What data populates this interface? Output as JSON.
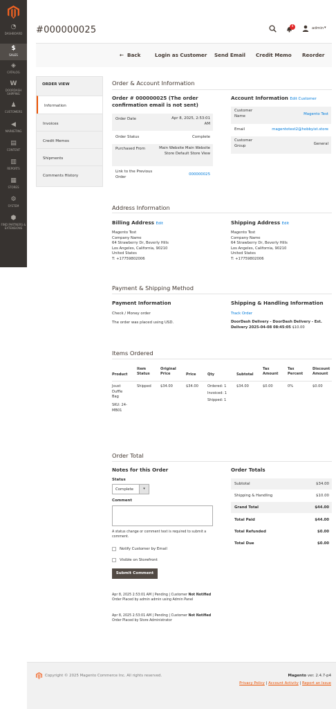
{
  "sidebar": {
    "items": [
      {
        "label": "DASHBOARD",
        "icon": "dashboard-icon"
      },
      {
        "label": "SALES",
        "icon": "dollar-icon"
      },
      {
        "label": "CATALOG",
        "icon": "cube-icon"
      },
      {
        "label": "DOORDASH SHIPPING",
        "icon": "doordash-icon"
      },
      {
        "label": "CUSTOMERS",
        "icon": "person-icon"
      },
      {
        "label": "MARKETING",
        "icon": "megaphone-icon"
      },
      {
        "label": "CONTENT",
        "icon": "content-icon"
      },
      {
        "label": "REPORTS",
        "icon": "bar-chart-icon"
      },
      {
        "label": "STORES",
        "icon": "store-icon"
      },
      {
        "label": "SYSTEM",
        "icon": "gear-icon"
      },
      {
        "label": "FIND PARTNERS & EXTENSIONS",
        "icon": "extensions-icon"
      }
    ]
  },
  "header": {
    "title": "#000000025",
    "notification_count": "4",
    "user": "admin"
  },
  "toolbar": {
    "back": "Back",
    "login_as_customer": "Login as Customer",
    "send_email": "Send Email",
    "credit_memo": "Credit Memo",
    "reorder": "Reorder"
  },
  "order_view": {
    "heading": "ORDER VIEW",
    "tabs": [
      "Information",
      "Invoices",
      "Credit Memos",
      "Shipments",
      "Comments History"
    ]
  },
  "order_account": {
    "section_title": "Order & Account Information",
    "order_heading_line1": "Order # 000000025    (The order",
    "order_heading_line2": "confirmation email is not sent)",
    "rows": [
      {
        "label": "Order Date",
        "value": "Apr 8, 2025, 2:53:01 AM"
      },
      {
        "label": "Order Status",
        "value": "Complete"
      },
      {
        "label": "Purchased From",
        "value": "Main Website Main Website Store Default Store View"
      },
      {
        "label": "Link to the Previous Order",
        "value": "000000025"
      }
    ],
    "account_title": "Account Information",
    "edit_customer": "Edit Customer",
    "account_rows": [
      {
        "label": "Customer Name",
        "value": "Magento Test"
      },
      {
        "label": "Email",
        "value": "magentotest2@hobbyist.store"
      },
      {
        "label": "Customer Group",
        "value": "General"
      }
    ]
  },
  "address": {
    "section_title": "Address Information",
    "billing_title": "Billing Address",
    "shipping_title": "Shipping Address",
    "edit": "Edit",
    "billing_lines": [
      "Magento Test",
      "Company Name",
      "64 Strawberry Dr, Beverly Hills",
      "Los Angeles, California, 90210",
      "United States",
      "T: +17759802006"
    ],
    "shipping_lines": [
      "Magento Test",
      "Company Name",
      "64 Strawberry Dr, Beverly Hills",
      "Los Angeles, California, 90210",
      "United States",
      "T: +17759802006"
    ]
  },
  "payment": {
    "section_title": "Payment & Shipping Method",
    "payment_title": "Payment Information",
    "method": "Check / Money order",
    "currency_note": "The order was placed using USD.",
    "shipping_title": "Shipping & Handling Information",
    "track_order": "Track Order",
    "delivery_line1": "DoorDash Delivery - DoorDash Delivery - Est.",
    "delivery_line2": "Delivery 2025-04-08 08:45:05",
    "delivery_price": "$10.00"
  },
  "items": {
    "section_title": "Items Ordered",
    "headers": [
      "Product",
      "Item Status",
      "Original Price",
      "Price",
      "Qty",
      "Subtotal",
      "Tax Amount",
      "Tax Percent",
      "Discount Amount"
    ],
    "row": {
      "product_name": "Joust Duffle Bag",
      "sku": "SKU: 24-MB01",
      "status": "Shipped",
      "original_price": "$34.00",
      "price": "$34.00",
      "qty_ordered": "Ordered: 1",
      "qty_invoiced": "Invoiced: 1",
      "qty_shipped": "Shipped: 1",
      "subtotal": "$34.00",
      "tax_amount": "$0.00",
      "tax_percent": "0%",
      "discount": "$0.00"
    }
  },
  "order_total": {
    "section_title": "Order Total",
    "notes_title": "Notes for this Order",
    "status_label": "Status",
    "status_value": "Complete",
    "comment_label": "Comment",
    "comment_hint": "A status change or comment text is required to submit a comment.",
    "notify_label": "Notify Customer by Email",
    "visible_label": "Visible on Storefront",
    "submit_label": "Submit Comment",
    "history": [
      {
        "meta": "Apr 8, 2025  2:53:01 AM  |  Pending  |  Customer ",
        "bold": "Not Notified",
        "text": "Order Placed by admin admin using Admin Panel"
      },
      {
        "meta": "Apr 8, 2025  2:53:01 AM  |  Pending  |  Customer ",
        "bold": "Not Notified",
        "text": "Order Placed by Store Administrator"
      }
    ],
    "totals_title": "Order Totals",
    "totals": [
      {
        "label": "Subtotal",
        "value": "$34.00"
      },
      {
        "label": "Shipping & Handling",
        "value": "$10.00"
      },
      {
        "label": "Grand Total",
        "value": "$44.00"
      },
      {
        "label": "Total Paid",
        "value": "$44.00"
      },
      {
        "label": "Total Refunded",
        "value": "$0.00"
      },
      {
        "label": "Total Due",
        "value": "$0.00"
      }
    ]
  },
  "footer": {
    "copyright": "Copyright © 2025 Magento Commerce Inc. All rights reserved.",
    "brand": "Magento",
    "version": "ver. 2.4.7-p4",
    "links": [
      "Privacy Policy",
      "Account Activity",
      "Report an Issue"
    ]
  },
  "colors": {
    "accent": "#eb5202",
    "link": "#007bdb",
    "sidebar": "#373330"
  }
}
